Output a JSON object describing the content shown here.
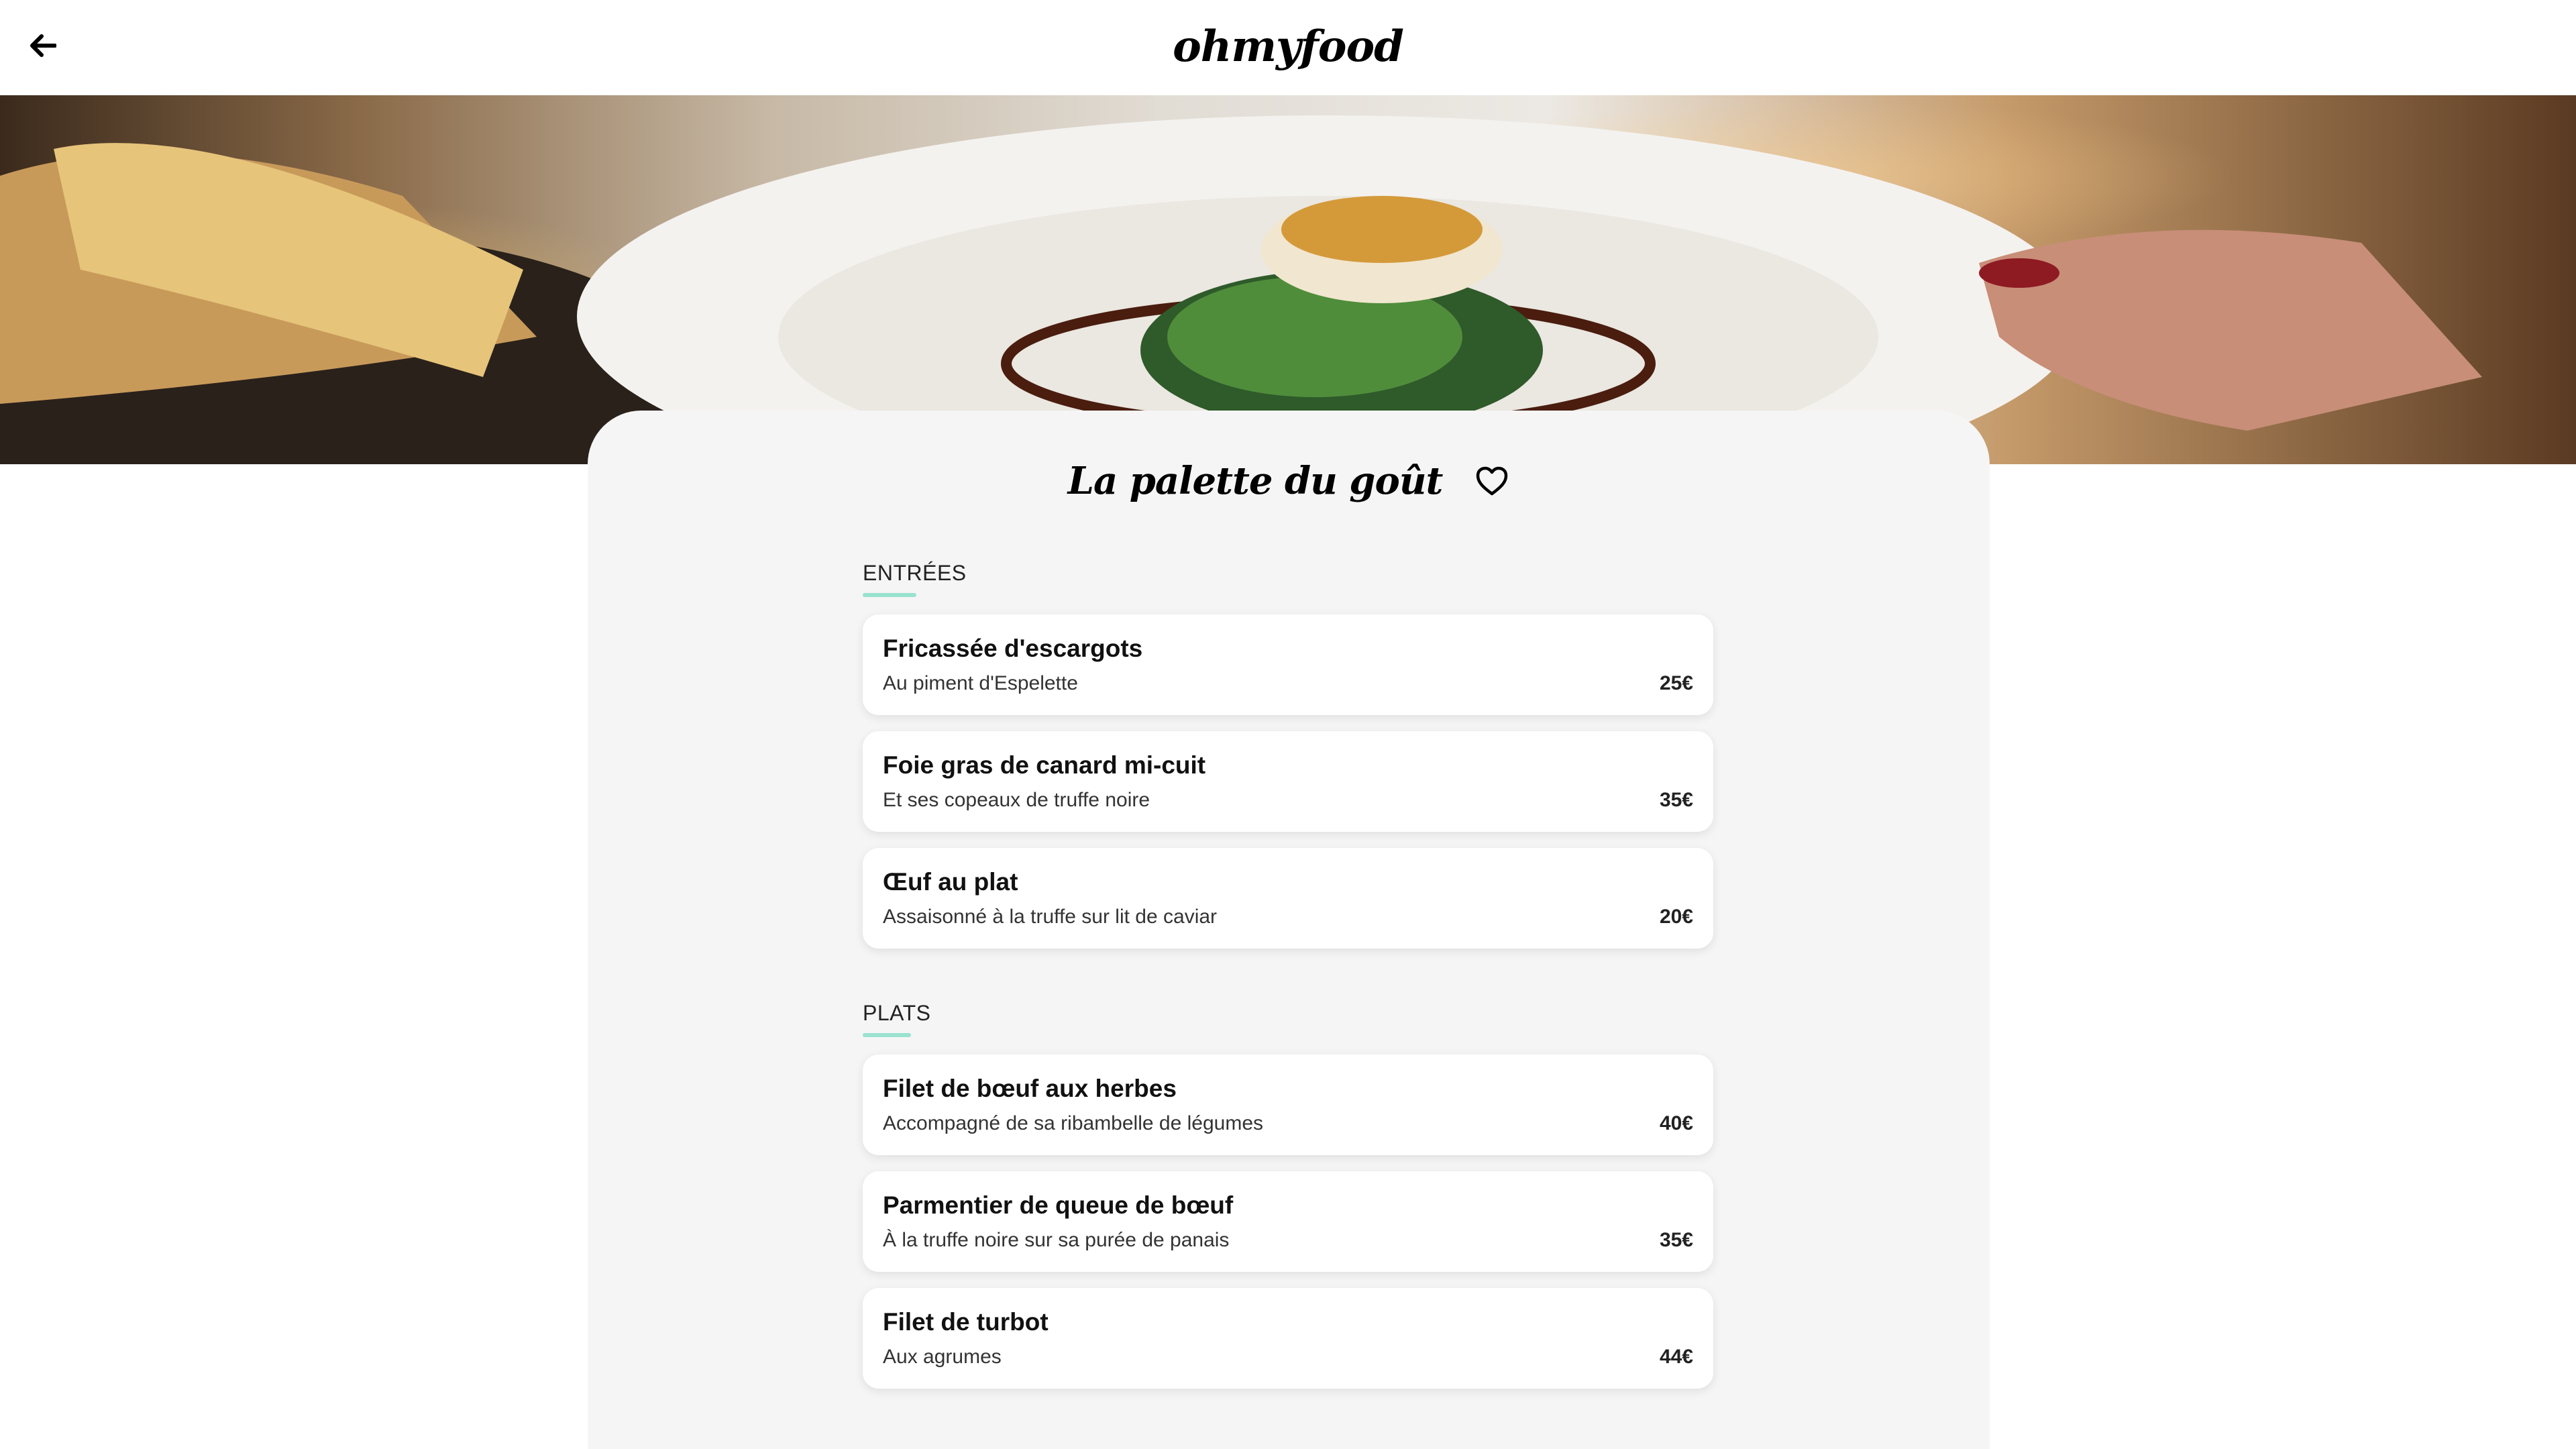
{
  "header": {
    "back_icon": "arrow-left-icon",
    "logo": "ohmyfood"
  },
  "hero": {
    "description": "restaurant-plate-photo"
  },
  "restaurant": {
    "name": "La palette du goût",
    "favorite_icon": "heart-outline-icon"
  },
  "sections": [
    {
      "title": "ENTRÉES",
      "items": [
        {
          "name": "Fricassée d'escargots",
          "desc": "Au piment d'Espelette",
          "price": "25€"
        },
        {
          "name": "Foie gras de canard mi-cuit",
          "desc": "Et ses copeaux de truffe noire",
          "price": "35€"
        },
        {
          "name": "Œuf au plat",
          "desc": "Assaisonné à la truffe sur lit de caviar",
          "price": "20€"
        }
      ]
    },
    {
      "title": "PLATS",
      "items": [
        {
          "name": "Filet de bœuf aux herbes",
          "desc": "Accompagné de sa ribambelle de légumes",
          "price": "40€"
        },
        {
          "name": "Parmentier de queue de bœuf",
          "desc": "À la truffe noire sur sa purée de panais",
          "price": "35€"
        },
        {
          "name": "Filet de turbot",
          "desc": "Aux agrumes",
          "price": "44€"
        }
      ]
    }
  ],
  "colors": {
    "accent": "#99e2d0",
    "card_bg": "#f5f5f5"
  }
}
